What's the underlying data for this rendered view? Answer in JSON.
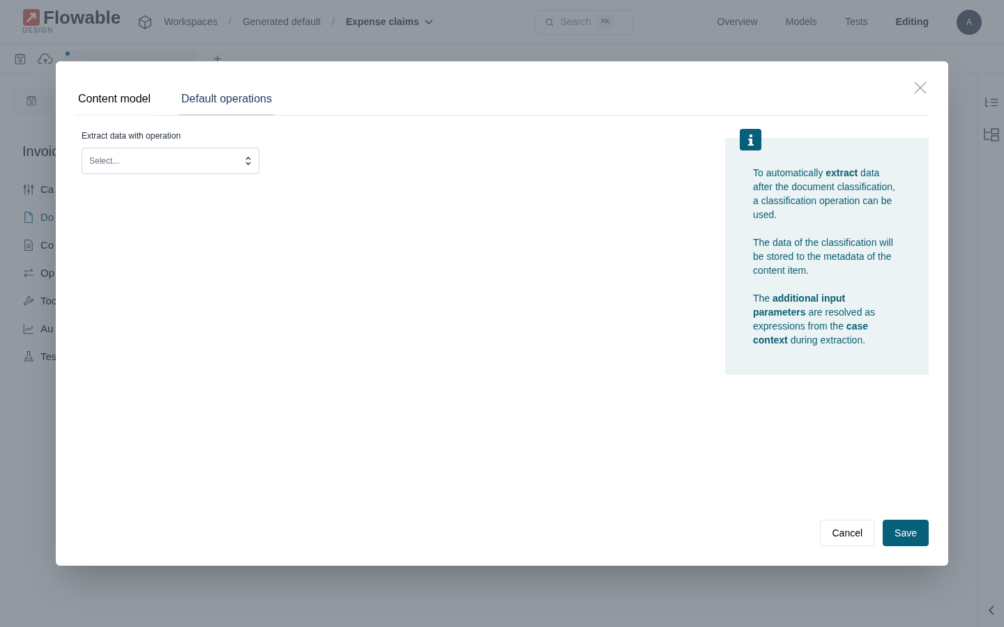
{
  "header": {
    "logo": {
      "text": "Flowable",
      "subtitle": "DESIGN"
    },
    "breadcrumb": [
      {
        "label": "Workspaces",
        "current": false
      },
      {
        "label": "Generated default",
        "current": false
      },
      {
        "label": "Expense claims",
        "current": true
      }
    ],
    "separator": "/",
    "search": {
      "placeholder": "Search",
      "shortcut": "⌘K"
    },
    "nav": [
      {
        "label": "Overview",
        "selected": false
      },
      {
        "label": "Models",
        "selected": false
      },
      {
        "label": "Tests",
        "selected": false
      },
      {
        "label": "Editing",
        "selected": true
      }
    ],
    "avatar": "A"
  },
  "editor_tabs": [
    {
      "modified": true
    }
  ],
  "add_tab": "+",
  "sidebar": {
    "title": "Invoic",
    "items": [
      {
        "label": "Ca",
        "selected": false
      },
      {
        "label": "Do",
        "selected": true
      },
      {
        "label": "Co",
        "selected": false
      },
      {
        "label": "Op",
        "selected": false
      },
      {
        "label": "Too",
        "selected": false
      },
      {
        "label": "Au",
        "selected": false
      },
      {
        "label": "Tes",
        "selected": false
      }
    ]
  },
  "dialog": {
    "tabs": [
      {
        "label": "Content model",
        "selected": false
      },
      {
        "label": "Default operations",
        "selected": true
      }
    ],
    "field": {
      "label": "Extract data with operation",
      "placeholder": "Select..."
    },
    "info": [
      "To automatically **extract** data after the document classification, a classification operation can be used.",
      "The data of the classification will be stored to the metadata of the content item.",
      "The **additional input parameters** are resolved as expressions from the **case context** during extraction."
    ],
    "buttons": [
      {
        "label": "Cancel",
        "kind": "secondary"
      },
      {
        "label": "Save",
        "kind": "primary"
      }
    ]
  }
}
